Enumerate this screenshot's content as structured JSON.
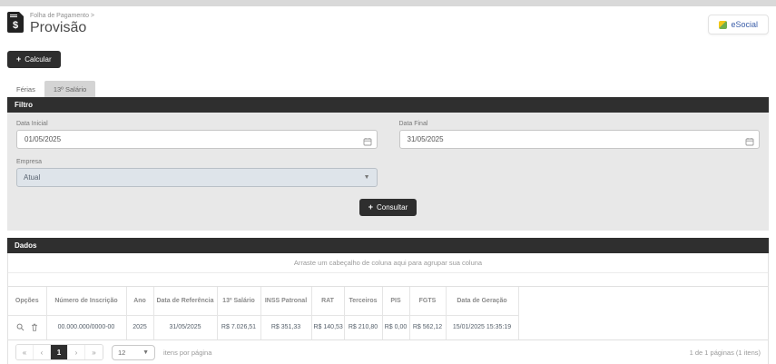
{
  "header": {
    "breadcrumb": "Folha de Pagamento >",
    "title": "Provisão",
    "doc_icon_glyph": "$",
    "esocial_label": "eSocial"
  },
  "actions": {
    "plus_glyph": "+",
    "calcular_label": "Calcular"
  },
  "tabs": {
    "ferias": "Férias",
    "decimo_terceiro": "13º Salário"
  },
  "filter": {
    "panel_title": "Filtro",
    "data_inicial_label": "Data Inicial",
    "data_inicial_value": "01/05/2025",
    "data_final_label": "Data Final",
    "data_final_value": "31/05/2025",
    "empresa_label": "Empresa",
    "empresa_value": "Atual",
    "caret_glyph": "▼",
    "consultar_label": "Consultar"
  },
  "dados": {
    "panel_title": "Dados",
    "group_panel_text": "Arraste um cabeçalho de coluna aqui para agrupar sua coluna",
    "columns": [
      "Opções",
      "Número de Inscrição",
      "Ano",
      "Data de Referência",
      "13º Salário",
      "INSS Patronal",
      "RAT",
      "Terceiros",
      "PIS",
      "FGTS",
      "Data de Geração"
    ],
    "row": {
      "numero_inscricao": "00.000.000/0000-00",
      "ano": "2025",
      "data_referencia": "31/05/2025",
      "decimo_terceiro_salario": "R$ 7.026,51",
      "inss_patronal": "R$ 351,33",
      "rat": "R$ 140,53",
      "terceiros": "R$ 210,80",
      "pis": "R$ 0,00",
      "fgts": "R$ 562,12",
      "data_geracao": "15/01/2025 15:35:19"
    },
    "pager": {
      "first": "«",
      "prev": "‹",
      "page": "1",
      "next": "›",
      "last": "»",
      "page_size": "12",
      "caret_glyph": "▼",
      "items_label": "itens por página",
      "summary": "1 de 1 páginas (1 itens)"
    }
  },
  "colors": {
    "dark": "#2e2e2e",
    "esocial_blue": "#3a5da8",
    "filter_bg": "#e8e8e8"
  }
}
